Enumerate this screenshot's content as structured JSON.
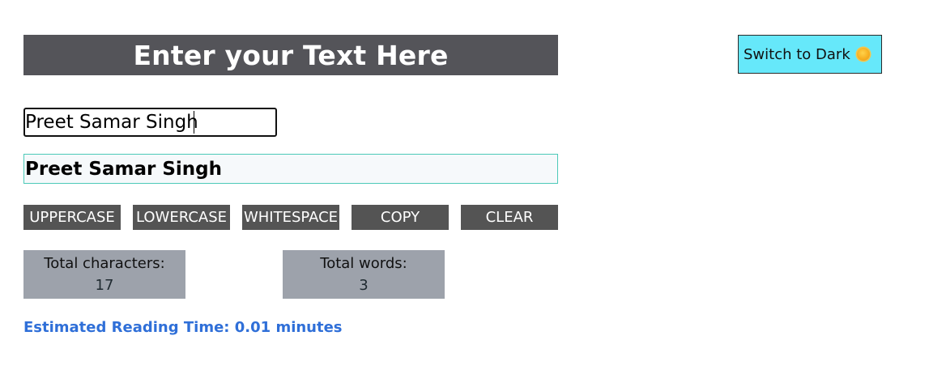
{
  "header": {
    "title": "Enter your Text Here"
  },
  "theme_toggle": {
    "label": "Switch to Dark",
    "icon": "sun-icon"
  },
  "input": {
    "value": "Preet Samar Singh",
    "placeholder": ""
  },
  "preview": {
    "text": "Preet Samar Singh"
  },
  "actions": {
    "uppercase": "UPPERCASE",
    "lowercase": "LOWERCASE",
    "whitespace": "WHITESPACE",
    "copy": "COPY",
    "clear": "CLEAR"
  },
  "stats": {
    "characters_label": "Total characters:",
    "characters_value": "17",
    "words_label": "Total words:",
    "words_value": "3"
  },
  "reading_time": "Estimated Reading Time: 0.01 minutes",
  "colors": {
    "header_bg": "#545459",
    "toggle_bg": "#66e8fa",
    "button_bg": "#545454",
    "stat_bg": "#9da2ab",
    "preview_border": "#4cc9b8",
    "reading_time_text": "#2f6fd8"
  }
}
